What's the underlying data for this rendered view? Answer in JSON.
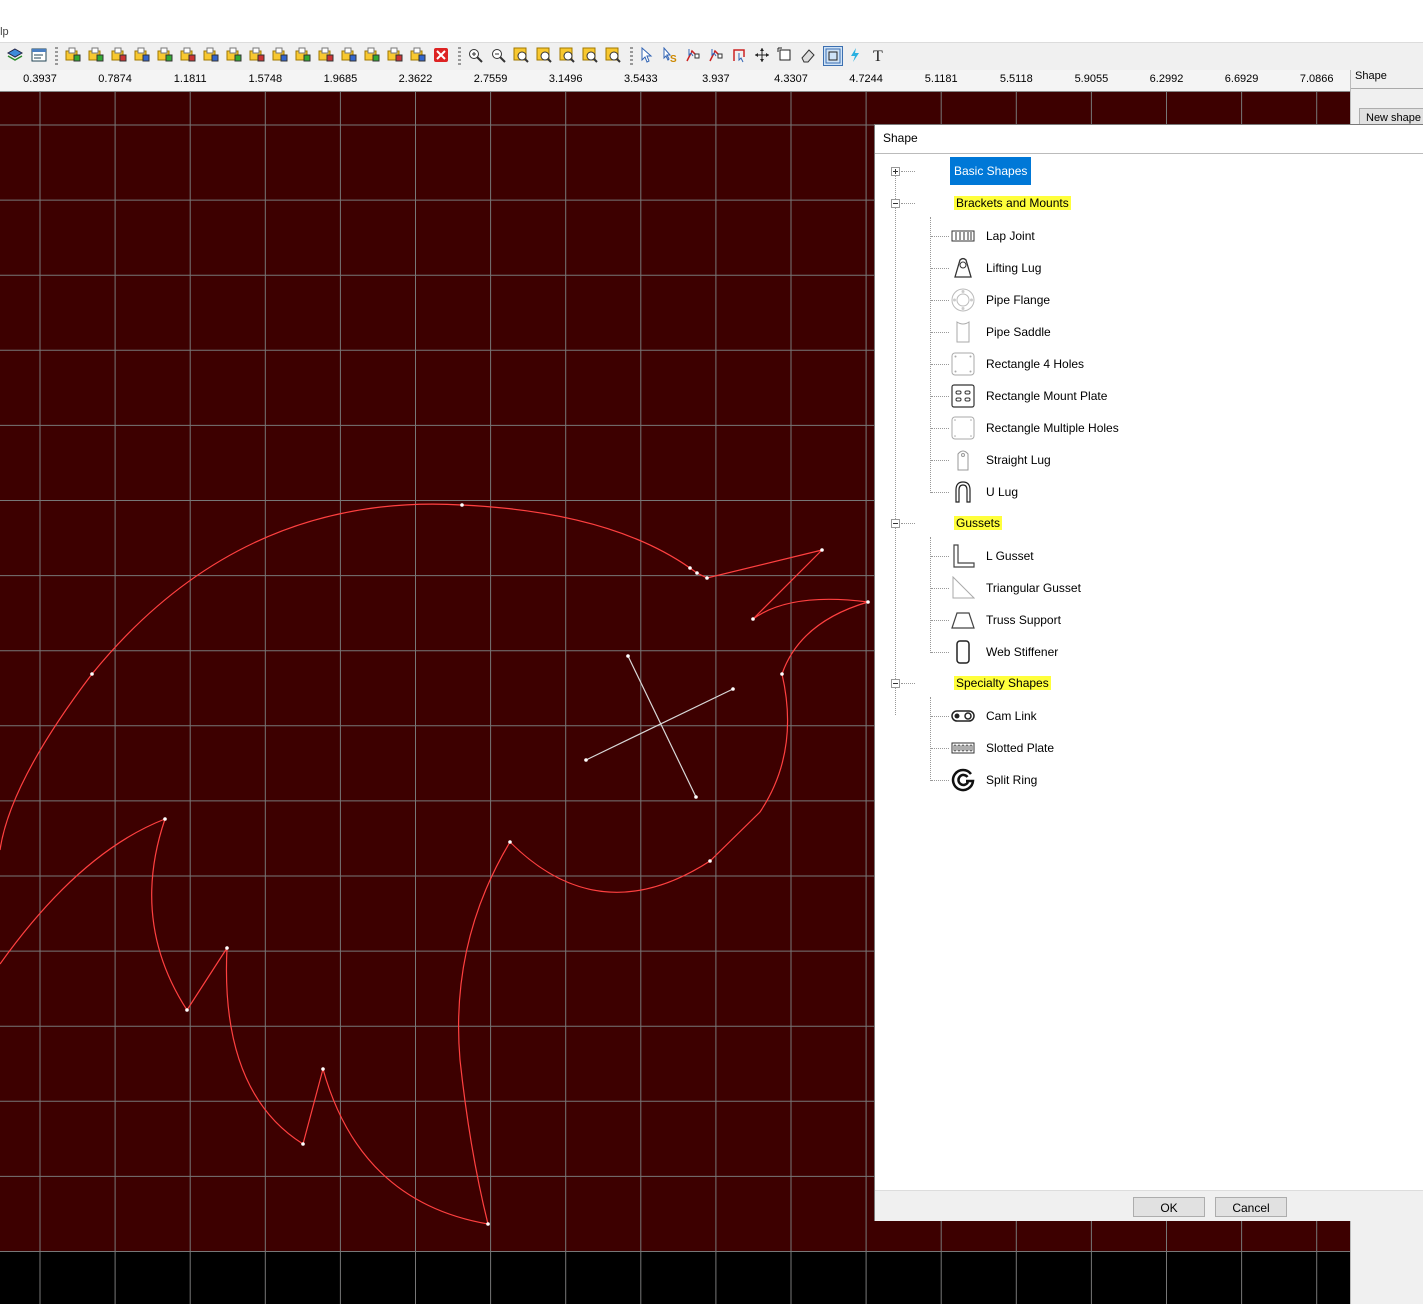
{
  "menu": {
    "help_label": "elp"
  },
  "toolbar": {
    "icons": [
      "layers-icon",
      "window-icon",
      "add-layer-icon",
      "layer-props-icon",
      "layer-1-icon",
      "layer-2-icon",
      "layer-3-icon",
      "layer-add-icon",
      "layer-move-icon",
      "layer-copy-icon",
      "layer-down-icon",
      "layer-cut-icon",
      "layer-check-icon",
      "layer-lock-icon",
      "layer-export-icon",
      "delete-icon",
      "zoom-in-icon",
      "zoom-out-icon",
      "zoom-window-icon",
      "zoom-fit-icon",
      "zoom-all-icon",
      "zoom-prev-icon",
      "redraw-icon",
      "select-arrow-icon",
      "select-s-icon",
      "node-edit-icon",
      "node-sketch-icon",
      "trim-icon",
      "move-icon",
      "scale-icon",
      "eraser-icon",
      "snap-icon",
      "lightning-icon",
      "text-tool-icon"
    ],
    "text_tool_glyph": "T"
  },
  "ruler": {
    "labels": [
      "0.3937",
      "0.7874",
      "1.1811",
      "1.5748",
      "1.9685",
      "2.3622",
      "2.7559",
      "3.1496",
      "3.5433",
      "3.937",
      "4.3307",
      "4.7244",
      "5.1181",
      "5.5118",
      "5.9055",
      "6.2992",
      "6.6929",
      "7.0866"
    ]
  },
  "right_panel": {
    "tab_label": "Shape",
    "new_shape_label": "New shape"
  },
  "colors": {
    "canvas_bg": "#3d0000",
    "grid": "#777777",
    "path": "#ff4040",
    "selection_accent": "#0078d7",
    "highlight": "#ffff3b"
  },
  "dialog": {
    "title": "Shape",
    "ok_label": "OK",
    "cancel_label": "Cancel",
    "categories": [
      {
        "label": "Basic Shapes",
        "expanded": false,
        "selected": true,
        "highlighted": false,
        "items": []
      },
      {
        "label": "Brackets and Mounts",
        "expanded": true,
        "selected": false,
        "highlighted": true,
        "items": [
          {
            "label": "Lap Joint",
            "icon": "lap-joint-icon"
          },
          {
            "label": "Lifting Lug",
            "icon": "lifting-lug-icon"
          },
          {
            "label": "Pipe Flange",
            "icon": "pipe-flange-icon"
          },
          {
            "label": "Pipe Saddle",
            "icon": "pipe-saddle-icon"
          },
          {
            "label": "Rectangle 4 Holes",
            "icon": "rectangle-4-holes-icon"
          },
          {
            "label": "Rectangle Mount Plate",
            "icon": "rectangle-mount-plate-icon"
          },
          {
            "label": "Rectangle Multiple Holes",
            "icon": "rectangle-multiple-holes-icon"
          },
          {
            "label": "Straight Lug",
            "icon": "straight-lug-icon"
          },
          {
            "label": "U Lug",
            "icon": "u-lug-icon"
          }
        ]
      },
      {
        "label": "Gussets",
        "expanded": true,
        "selected": false,
        "highlighted": true,
        "items": [
          {
            "label": "L Gusset",
            "icon": "l-gusset-icon"
          },
          {
            "label": "Triangular Gusset",
            "icon": "triangular-gusset-icon"
          },
          {
            "label": "Truss Support",
            "icon": "truss-support-icon"
          },
          {
            "label": "Web Stiffener",
            "icon": "web-stiffener-icon"
          }
        ]
      },
      {
        "label": "Specialty Shapes",
        "expanded": true,
        "selected": false,
        "highlighted": true,
        "items": [
          {
            "label": "Cam Link",
            "icon": "cam-link-icon"
          },
          {
            "label": "Slotted Plate",
            "icon": "slotted-plate-icon"
          },
          {
            "label": "Split Ring",
            "icon": "split-ring-icon"
          }
        ]
      }
    ]
  }
}
